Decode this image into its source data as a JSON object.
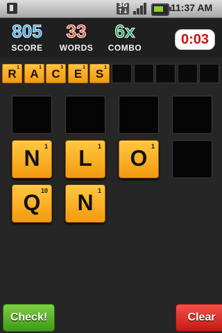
{
  "status_bar": {
    "time": "11:37 AM",
    "network": "3G",
    "icons": [
      "notification-icon",
      "3g-icon",
      "signal-icon",
      "battery-icon"
    ]
  },
  "stats": {
    "score": {
      "value": "805",
      "label": "SCORE",
      "color": "#2fa8e8"
    },
    "words": {
      "value": "33",
      "label": "WORDS",
      "color": "#e8552a"
    },
    "combo": {
      "value": "6x",
      "label": "COMBO",
      "color": "#21a45a"
    },
    "timer": "0:03"
  },
  "current_word": {
    "tiles": [
      {
        "letter": "R",
        "points": "1"
      },
      {
        "letter": "A",
        "points": "1"
      },
      {
        "letter": "C",
        "points": "3"
      },
      {
        "letter": "E",
        "points": "1"
      },
      {
        "letter": "S",
        "points": "1"
      }
    ],
    "empty_slots": 5
  },
  "board": [
    {
      "letter": "",
      "points": ""
    },
    {
      "letter": "",
      "points": ""
    },
    {
      "letter": "",
      "points": ""
    },
    {
      "letter": "",
      "points": ""
    },
    {
      "letter": "N",
      "points": "1"
    },
    {
      "letter": "L",
      "points": "1"
    },
    {
      "letter": "O",
      "points": "1"
    },
    {
      "letter": "",
      "points": ""
    },
    {
      "letter": "Q",
      "points": "10"
    },
    {
      "letter": "N",
      "points": "1"
    }
  ],
  "buttons": {
    "check": "Check!",
    "clear": "Clear"
  }
}
